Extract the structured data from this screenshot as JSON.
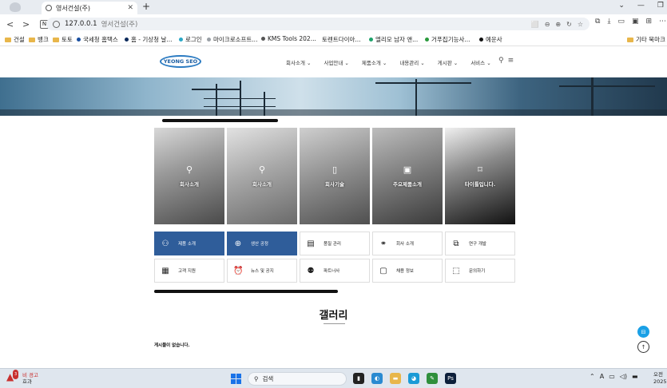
{
  "browser": {
    "tab_title": "영서건설(주)",
    "tab_close": "✕",
    "new_tab": "+",
    "url_host": "127.0.0.1",
    "url_site": "영서건설(주)",
    "addr_n": "N",
    "window_controls": [
      "⌄",
      "—",
      "❐"
    ],
    "url_icons": [
      "⬜",
      "⊖",
      "⊕",
      "↻",
      "☆"
    ],
    "toolbar_icons": [
      "⧉",
      "⤓",
      "▭",
      "▣",
      "⊞",
      "⋯"
    ]
  },
  "bookmarks": [
    {
      "label": "건설",
      "kind": "folder",
      "color": "#e8b64a"
    },
    {
      "label": "뱅크",
      "kind": "folder",
      "color": "#e8b64a"
    },
    {
      "label": "토토",
      "kind": "folder",
      "color": "#e8b64a"
    },
    {
      "label": "국세청 홈택스",
      "kind": "dot",
      "color": "#1a4fa0"
    },
    {
      "label": "홈 - 기상청 날...",
      "kind": "dot",
      "color": "#0b2a5b"
    },
    {
      "label": "로그인",
      "kind": "dot",
      "color": "#2aa8c6"
    },
    {
      "label": "마이크로소프트...",
      "kind": "dot",
      "color": "#9aa0a6"
    },
    {
      "label": "KMS Tools 202...",
      "kind": "dot",
      "color": "#555555"
    },
    {
      "label": "토렌트다이아...",
      "kind": "none",
      "color": ""
    },
    {
      "label": "엘리모 남자 앤...",
      "kind": "dot",
      "color": "#1ea36b"
    },
    {
      "label": "거푸집기능사...",
      "kind": "dot",
      "color": "#2a9a3c"
    },
    {
      "label": "예운사",
      "kind": "dot",
      "color": "#111111"
    },
    {
      "label": "기타 북마크",
      "kind": "folder",
      "color": "#e8b64a"
    }
  ],
  "site": {
    "logo": "YEONG SEO",
    "nav": [
      "회사소개 ⌄",
      "사업안내 ⌄",
      "제품소개 ⌄",
      "내용관리 ⌄",
      "게시판 ⌄",
      "서비스 ⌄"
    ],
    "search_icon": "⚲",
    "menu_icon": "≡"
  },
  "cards": [
    {
      "label": "회사소개",
      "icon": "⚲",
      "bg": "linear-gradient(160deg,#d8d8d8 0%,#9a9a9a 40%,#4a4a4a 100%)"
    },
    {
      "label": "회사소개",
      "icon": "⚲",
      "bg": "linear-gradient(160deg,#e2e2e2 0%,#a8a8a8 45%,#6a6a6a 100%)"
    },
    {
      "label": "회사기술",
      "icon": "▯",
      "bg": "linear-gradient(160deg,#cfcfcf 0%,#8c8c8c 50%,#4f4f4f 100%)"
    },
    {
      "label": "주요제품소개",
      "icon": "▣",
      "bg": "linear-gradient(160deg,#bdbdbd 0%,#7a7a7a 50%,#3a3a3a 100%)"
    },
    {
      "label": "타이틀입니다.",
      "icon": "⌑",
      "bg": "linear-gradient(160deg,#f0f0f0 0%,#8a8a8a 40%,#111111 100%)"
    }
  ],
  "menu": [
    {
      "label": "제품 소개",
      "icon": "⚇",
      "active": true
    },
    {
      "label": "생산 공정",
      "icon": "⊕",
      "active": true
    },
    {
      "label": "품질 관리",
      "icon": "▤",
      "active": false
    },
    {
      "label": "회사 소개",
      "icon": "⚭",
      "active": false
    },
    {
      "label": "연구 개발",
      "icon": "⧉",
      "active": false
    },
    {
      "label": "고객 지원",
      "icon": "▦",
      "active": false
    },
    {
      "label": "뉴스 및 공지",
      "icon": "⏰",
      "active": false
    },
    {
      "label": "파트너사",
      "icon": "⚉",
      "active": false
    },
    {
      "label": "채용 정보",
      "icon": "▢",
      "active": false
    },
    {
      "label": "문의하기",
      "icon": "⬚",
      "active": false
    }
  ],
  "gallery": {
    "title": "갤러리",
    "empty": "게시물이 없습니다."
  },
  "float": {
    "chat": "⊟",
    "top": "↑"
  },
  "taskbar": {
    "warn_count": "3",
    "warn_title": "비 경고",
    "warn_sub": "효과",
    "search": "검색",
    "search_icon": "⚲",
    "apps": [
      {
        "icon": "▮",
        "color": "#222222"
      },
      {
        "icon": "◐",
        "color": "#2a8ad1"
      },
      {
        "icon": "▬",
        "color": "#e8b64a"
      },
      {
        "icon": "◕",
        "color": "#1a9ad6"
      },
      {
        "icon": "✎",
        "color": "#2f8f3c"
      },
      {
        "icon": "Ps",
        "color": "#0d1f3a"
      }
    ],
    "tray": [
      "⌃",
      "A",
      "▭",
      "◁)",
      "▬"
    ],
    "clock_time": "오전",
    "clock_date": "2025"
  }
}
